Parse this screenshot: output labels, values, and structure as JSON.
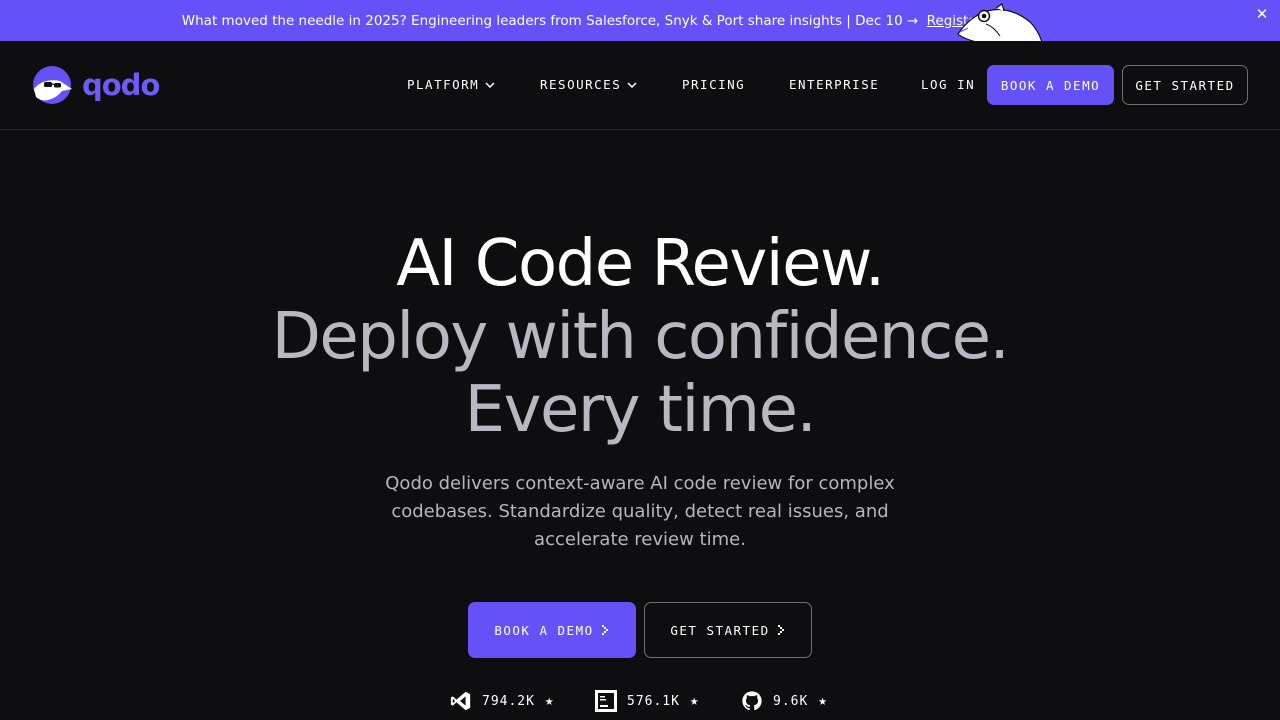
{
  "announcement": {
    "message": "What moved the needle in 2025? Engineering leaders from Salesforce, Snyk & Port share insights | Dec 10 →",
    "link_label": "Register",
    "close_glyph": "✕"
  },
  "brand": {
    "name": "qodo",
    "color": "#6c5cf7",
    "accent": "#6451f7"
  },
  "nav": {
    "items": [
      {
        "label": "PLATFORM"
      },
      {
        "label": "RESOURCES"
      },
      {
        "label": "PRICING"
      },
      {
        "label": "ENTERPRISE"
      },
      {
        "label": "LOG IN"
      }
    ],
    "book_demo": "BOOK A DEMO",
    "get_started": "GET STARTED"
  },
  "hero": {
    "line1": "AI Code Review.",
    "line2": "Deploy with confidence.",
    "line3": "Every time.",
    "subtitle": "Qodo delivers context-aware AI code review for complex codebases. Standardize quality, detect real issues, and accelerate review time.",
    "cta_primary": "BOOK A DEMO",
    "cta_secondary": "GET STARTED"
  },
  "stats": [
    {
      "icon": "vscode-icon",
      "value": "794.2K"
    },
    {
      "icon": "jetbrains-icon",
      "value": "576.1K"
    },
    {
      "icon": "github-icon",
      "value": "9.6K"
    }
  ]
}
